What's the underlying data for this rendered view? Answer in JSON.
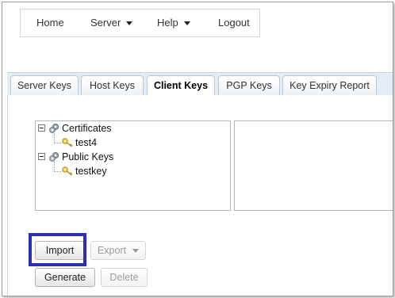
{
  "nav": {
    "home": "Home",
    "server": "Server",
    "help": "Help",
    "logout": "Logout"
  },
  "tabs": [
    {
      "label": "Server Keys",
      "active": false
    },
    {
      "label": "Host Keys",
      "active": false
    },
    {
      "label": "Client Keys",
      "active": true
    },
    {
      "label": "PGP Keys",
      "active": false
    },
    {
      "label": "Key Expiry Report",
      "active": false
    }
  ],
  "tree": {
    "certificates": {
      "label": "Certificates",
      "children": [
        "test4"
      ]
    },
    "public_keys": {
      "label": "Public Keys",
      "children": [
        "testkey"
      ]
    }
  },
  "buttons": {
    "import": "Import",
    "export": "Export",
    "generate": "Generate",
    "delete": "Delete"
  },
  "colors": {
    "highlight": "#2b2fb8",
    "tabbar": "#e4edf6"
  },
  "icons": {
    "folder": "gear-folder-icon",
    "key": "key-icon"
  }
}
